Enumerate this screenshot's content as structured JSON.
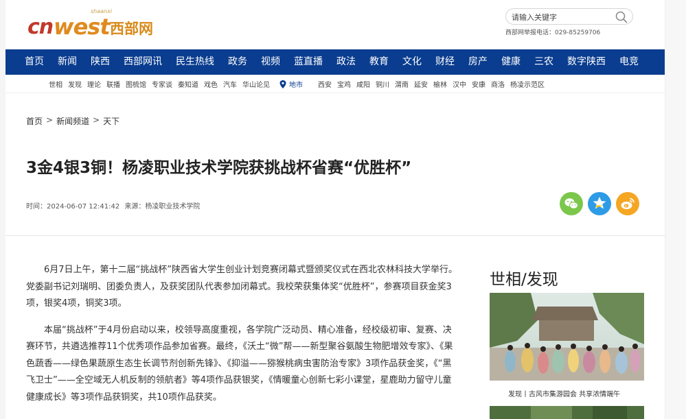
{
  "header": {
    "logo_cn": "cn",
    "logo_west": "west",
    "logo_small": "shaanxi",
    "logo_zh": "西部网",
    "search_placeholder": "请输入关键字",
    "hotline": "西部网举报电话：029-85259706"
  },
  "nav": {
    "items": [
      "首页",
      "新闻",
      "陕西",
      "西部网讯",
      "民生热线",
      "政务",
      "视频",
      "蓝直播",
      "政法",
      "教育",
      "文化",
      "财经",
      "房产",
      "健康",
      "三农",
      "数字陕西",
      "电竞"
    ]
  },
  "subnav": {
    "items": [
      "世相",
      "发现",
      "理论",
      "联播",
      "图梳馆",
      "专家谈",
      "秦知道",
      "戏色",
      "汽车",
      "华山论见"
    ],
    "region_label": "地市",
    "cities": [
      "西安",
      "宝鸡",
      "咸阳",
      "铜川",
      "渭南",
      "延安",
      "榆林",
      "汉中",
      "安康",
      "商洛",
      "杨凌示范区"
    ]
  },
  "breadcrumb": {
    "items": [
      "首页",
      "新闻频道",
      "天下"
    ],
    "separator": ">"
  },
  "article": {
    "title": "3金4银3铜！杨凌职业技术学院获挑战杯省赛“优胜杯”",
    "time": "时间：2024-06-07 12:41:42",
    "source": "来源：杨凌职业技术学院",
    "paragraphs": [
      "6月7日上午，第十二届“挑战杯”陕西省大学生创业计划竞赛闭幕式暨颁奖仪式在西北农林科技大学举行。党委副书记刘瑞明、团委负责人，及获奖团队代表参加闭幕式。我校荣获集体奖“优胜杯”，参赛项目获金奖3项，银奖4项，铜奖3项。",
      "本届“挑战杯”于4月份启动以来，校领导高度重视，各学院广泛动员、精心准备，经校级初审、复赛、决赛环节，共遴选推荐11个优秀项作品参加省赛。最终，《沃土“微”帮——新型聚谷氨酸生物肥增效专家》、《果色蔬香——绿色果蔬原生态生长调节剂创新先锋》、《抑溢——猕猴桃病虫害防治专家》3项作品获金奖，《“黑飞卫士”——全空域无人机反制的领航者》等4项作品获银奖，《情暖童心创新七彩小课堂，星鹿助力留守儿童健康成长》等3项作品获铜奖，共10项作品获奖。"
    ]
  },
  "share": {
    "icons": [
      "wechat-icon",
      "qzone-icon",
      "weibo-icon"
    ],
    "colors": {
      "wechat": "#7bc74b",
      "qzone": "#2e9be6",
      "weibo": "#f5a623"
    }
  },
  "sidebar": {
    "title": "世相/发现",
    "caption": "发现丨古风市集游园会 共享浓情端午"
  },
  "colors": {
    "nav_bg": "#0a3d8f",
    "logo_red": "#c0392b",
    "logo_orange": "#e08a1e"
  }
}
